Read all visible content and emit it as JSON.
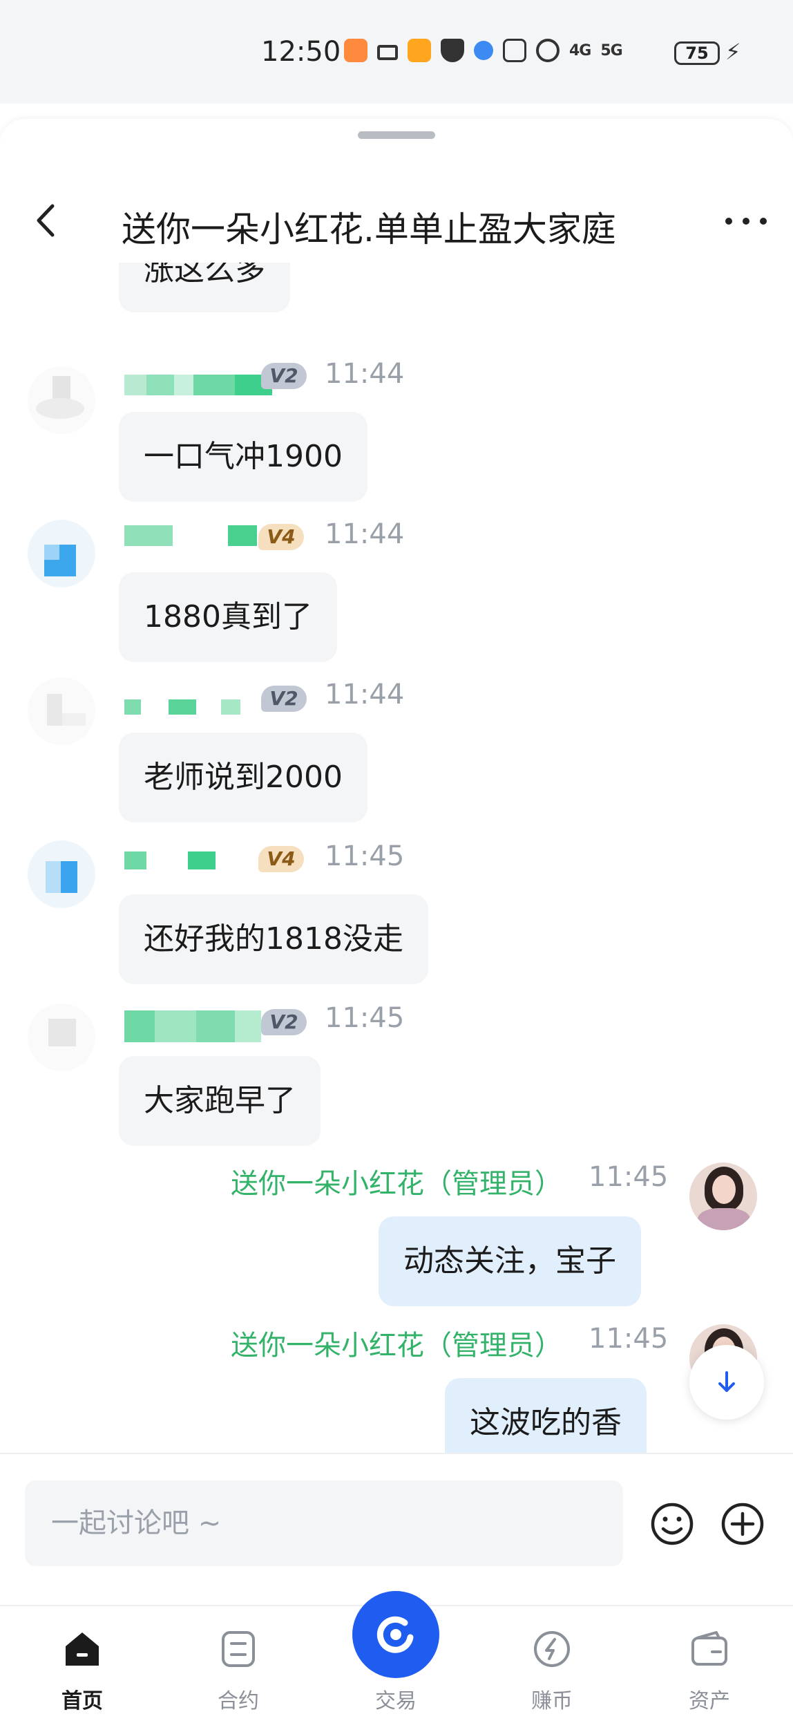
{
  "status_bar": {
    "time": "12:50",
    "signal_4g": "4G",
    "signal_5g": "5G",
    "battery": "75"
  },
  "header": {
    "title": "送你一朵小红花.单单止盈大家庭"
  },
  "messages": [
    {
      "text": "涨这么多"
    },
    {
      "badge": "V2",
      "time": "11:44",
      "text": "一口气冲1900"
    },
    {
      "badge": "V4",
      "time": "11:44",
      "text": "1880真到了"
    },
    {
      "badge": "V2",
      "time": "11:44",
      "text": "老师说到2000"
    },
    {
      "badge": "V4",
      "time": "11:45",
      "text": "还好我的1818没走"
    },
    {
      "badge": "V2",
      "time": "11:45",
      "text": "大家跑早了"
    },
    {
      "sender": "送你一朵小红花（管理员）",
      "time": "11:45",
      "text": "动态关注，宝子"
    },
    {
      "sender": "送你一朵小红花（管理员）",
      "time": "11:45",
      "text": "这波吃的香"
    }
  ],
  "input": {
    "placeholder": "一起讨论吧 ~"
  },
  "bottom_nav": {
    "items": [
      {
        "label": "首页",
        "icon": "home-icon",
        "active": true
      },
      {
        "label": "合约",
        "icon": "contract-icon",
        "active": false
      },
      {
        "label": "交易",
        "icon": "trade-icon",
        "active": false
      },
      {
        "label": "赚币",
        "icon": "earn-icon",
        "active": false
      },
      {
        "label": "资产",
        "icon": "wallet-icon",
        "active": false
      }
    ]
  },
  "colors": {
    "accent": "#1f5cf0",
    "admin_name": "#33b36a",
    "bubble_other": "#f4f5f7",
    "bubble_mine": "#e1eefc"
  }
}
